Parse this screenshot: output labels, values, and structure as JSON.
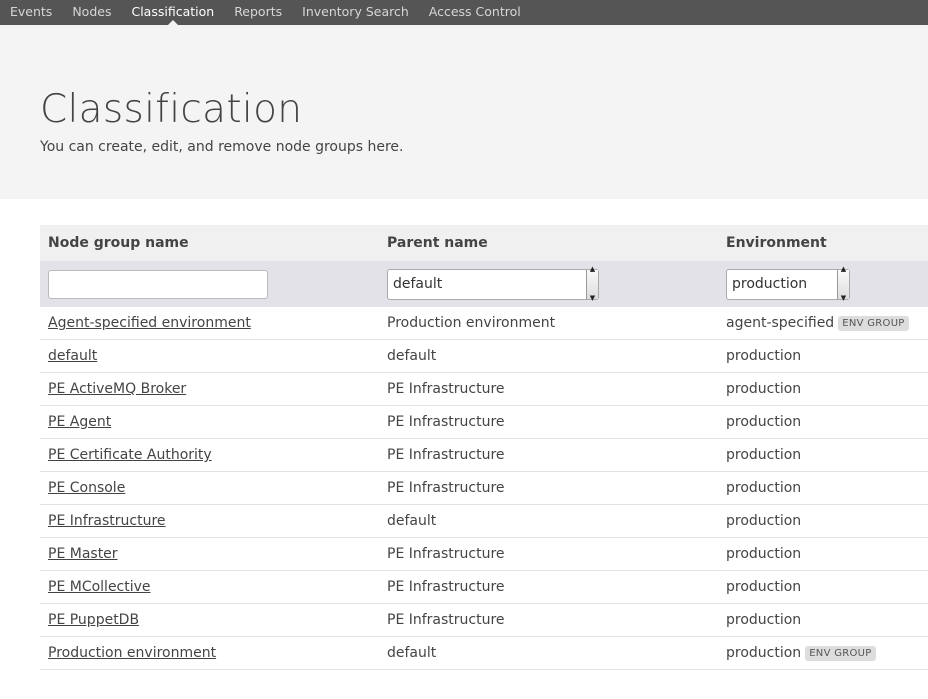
{
  "nav": {
    "items": [
      "Events",
      "Nodes",
      "Classification",
      "Reports",
      "Inventory Search",
      "Access Control"
    ],
    "active": "Classification"
  },
  "page": {
    "title": "Classification",
    "subtitle": "You can create, edit, and remove node groups here."
  },
  "table": {
    "columns": [
      "Node group name",
      "Parent name",
      "Environment"
    ],
    "filters": {
      "name_value": "",
      "parent_value": "default",
      "environment_value": "production"
    },
    "rows": [
      {
        "name": "Agent-specified environment",
        "parent": "Production environment",
        "environment": "agent-specified",
        "badge": "ENV GROUP"
      },
      {
        "name": "default",
        "parent": "default",
        "environment": "production",
        "badge": ""
      },
      {
        "name": "PE ActiveMQ Broker",
        "parent": "PE Infrastructure",
        "environment": "production",
        "badge": ""
      },
      {
        "name": "PE Agent",
        "parent": "PE Infrastructure",
        "environment": "production",
        "badge": ""
      },
      {
        "name": "PE Certificate Authority",
        "parent": "PE Infrastructure",
        "environment": "production",
        "badge": ""
      },
      {
        "name": "PE Console",
        "parent": "PE Infrastructure",
        "environment": "production",
        "badge": ""
      },
      {
        "name": "PE Infrastructure",
        "parent": "default",
        "environment": "production",
        "badge": ""
      },
      {
        "name": "PE Master",
        "parent": "PE Infrastructure",
        "environment": "production",
        "badge": ""
      },
      {
        "name": "PE MCollective",
        "parent": "PE Infrastructure",
        "environment": "production",
        "badge": ""
      },
      {
        "name": "PE PuppetDB",
        "parent": "PE Infrastructure",
        "environment": "production",
        "badge": ""
      },
      {
        "name": "Production environment",
        "parent": "default",
        "environment": "production",
        "badge": "ENV GROUP"
      }
    ]
  }
}
